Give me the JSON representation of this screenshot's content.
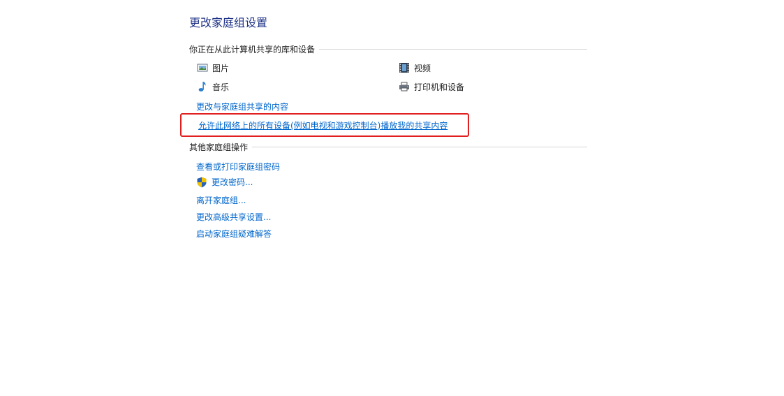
{
  "title": "更改家庭组设置",
  "sharing_section": {
    "header": "你正在从此计算机共享的库和设备",
    "libraries": [
      {
        "label": "图片",
        "icon": "pictures-icon"
      },
      {
        "label": "视频",
        "icon": "videos-icon"
      },
      {
        "label": "音乐",
        "icon": "music-icon"
      },
      {
        "label": "打印机和设备",
        "icon": "printer-icon"
      }
    ],
    "change_shared_link": "更改与家庭组共享的内容",
    "allow_devices_link": "允许此网络上的所有设备(例如电视和游戏控制台)播放我的共享内容"
  },
  "other_section": {
    "header": "其他家庭组操作",
    "links": [
      "查看或打印家庭组密码",
      "更改密码...",
      "离开家庭组...",
      "更改高级共享设置...",
      "启动家庭组疑难解答"
    ]
  },
  "colors": {
    "title": "#1e3287",
    "link": "#0066cc",
    "highlight": "#e02020"
  }
}
